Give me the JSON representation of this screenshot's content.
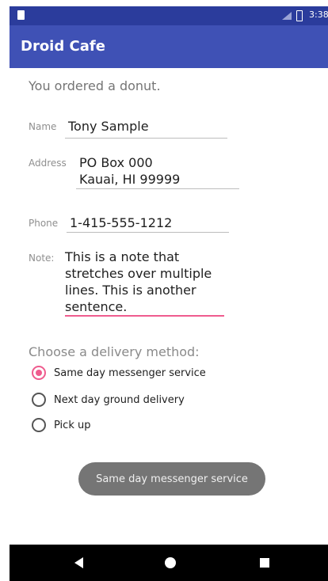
{
  "status_bar": {
    "time": "3:38",
    "bg_color": "#2b3c9c",
    "icons": [
      "sd-card-icon",
      "signal-icon",
      "battery-icon"
    ]
  },
  "app_bar": {
    "title": "Droid Cafe",
    "color": "#3f51b5"
  },
  "order": {
    "message": "You ordered a donut."
  },
  "form": {
    "name_label": "Name",
    "name_value": "Tony Sample",
    "address_label": "Address",
    "address_value": "PO Box 000\nKauai, HI 99999",
    "phone_label": "Phone",
    "phone_value": "1-415-555-1212",
    "note_label": "Note:",
    "note_value": "This is a note that\nstretches over multiple\nlines. This is another\nsentence.",
    "accent_color": "#ef5c8e"
  },
  "delivery": {
    "title": "Choose a delivery method:",
    "options": [
      {
        "label": "Same day messenger service",
        "selected": true
      },
      {
        "label": "Next day ground delivery",
        "selected": false
      },
      {
        "label": "Pick up",
        "selected": false
      }
    ]
  },
  "toast": {
    "text": "Same day messenger service"
  },
  "nav_bar": {
    "icons": [
      "back-icon",
      "home-icon",
      "recents-icon"
    ]
  }
}
